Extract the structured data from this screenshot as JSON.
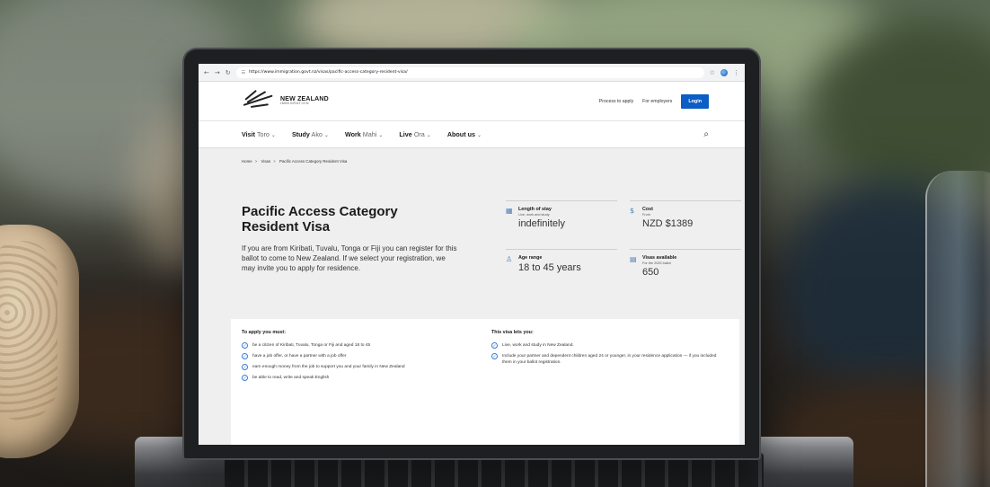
{
  "browser": {
    "url": "https://www.immigration.govt.nz/visas/pacific-access-category-resident-visa/",
    "back_icon": "arrow-left-icon",
    "forward_icon": "arrow-right-icon",
    "reload_icon": "reload-icon",
    "tune_icon": "site-settings-icon",
    "star_icon": "star-icon",
    "menu_icon": "kebab-menu-icon"
  },
  "header": {
    "logo_main": "NEW ZEALAND",
    "logo_sub": "IMMIGRATION",
    "links": [
      "Process to apply",
      "For employers"
    ],
    "login_label": "Login"
  },
  "nav": {
    "items": [
      {
        "label": "Visit",
        "sub": "Toro"
      },
      {
        "label": "Study",
        "sub": "Ako"
      },
      {
        "label": "Work",
        "sub": "Mahi"
      },
      {
        "label": "Live",
        "sub": "Ora"
      },
      {
        "label": "About us",
        "sub": ""
      }
    ],
    "chevron": "⌄"
  },
  "breadcrumb": [
    "Home",
    "Visas",
    "Pacific Access Category Resident Visa"
  ],
  "hero": {
    "title": "Pacific Access Category Resident Visa",
    "text": "If you are from Kiribati, Tuvalu, Tonga or Fiji you can register for this ballot to come to New Zealand. If we select your registration, we may invite you to apply for residence."
  },
  "facts": {
    "length": {
      "label": "Length of stay",
      "sub": "Live, work and study",
      "value": "indefinitely"
    },
    "cost": {
      "label": "Cost",
      "sub": "From",
      "value": "NZD $1389"
    },
    "age": {
      "label": "Age range",
      "sub": "",
      "value": "18 to 45 years"
    },
    "visas": {
      "label": "Visas available",
      "sub": "For the 2025 ballot",
      "value": "650"
    }
  },
  "requirements": {
    "must_title": "To apply you must:",
    "must": [
      "be a citizen of Kiribati, Tuvalu, Tonga or Fiji and aged 18 to 45",
      "have a job offer, or have a partner with a job offer",
      "earn enough money from the job to support you and your family in New Zealand",
      "be able to read, write and speak English"
    ],
    "lets_title": "This visa lets you:",
    "lets": [
      "Live, work and study in New Zealand.",
      "Include your partner and dependent children aged 24 or younger, in your residence application — if you included them in your ballot registration."
    ]
  },
  "colors": {
    "accent": "#0c5dc4",
    "check": "#3a7bd5",
    "page_bg": "#efefef"
  }
}
